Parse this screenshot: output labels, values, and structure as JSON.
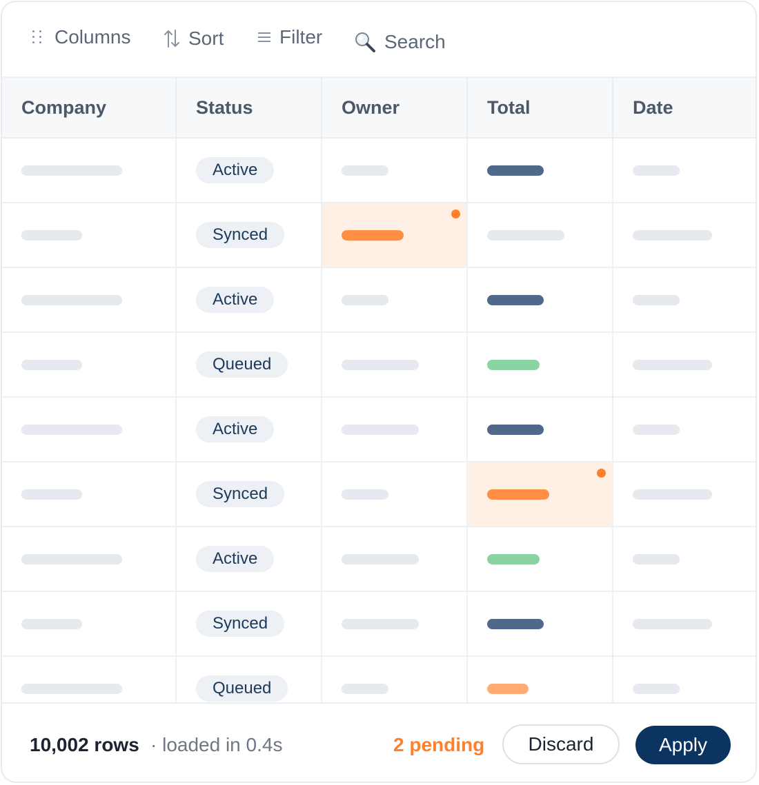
{
  "toolbar": {
    "columns_label": "Columns",
    "sort_label": "Sort",
    "filter_label": "Filter",
    "search_placeholder": "Search"
  },
  "table": {
    "columns": [
      "Company",
      "Status",
      "Owner",
      "Total",
      "Date"
    ],
    "rows": [
      {
        "status": "Active",
        "total_style": "dark",
        "edited": null
      },
      {
        "status": "Synced",
        "total_style": "muted",
        "edited": "owner"
      },
      {
        "status": "Active",
        "total_style": "dark",
        "edited": null
      },
      {
        "status": "Queued",
        "total_style": "green",
        "edited": null
      },
      {
        "status": "Active",
        "total_style": "dark",
        "edited": null
      },
      {
        "status": "Synced",
        "total_style": "orange",
        "edited": "total"
      },
      {
        "status": "Active",
        "total_style": "green",
        "edited": null
      },
      {
        "status": "Synced",
        "total_style": "dark",
        "edited": null
      },
      {
        "status": "Queued",
        "total_style": "light-orange",
        "edited": null
      }
    ]
  },
  "colors": {
    "dark": "#50698a",
    "green": "#8ad4a3",
    "orange": "#ff8f45",
    "light-orange": "#ffab73",
    "muted": "#e6e9ed",
    "accent": "#ff7f2a",
    "primary": "#0c3461"
  },
  "footer": {
    "rows_count": "10,002 rows",
    "loaded_text": "· loaded in 0.4s",
    "pending_text": "2 pending",
    "discard_label": "Discard",
    "apply_label": "Apply"
  }
}
